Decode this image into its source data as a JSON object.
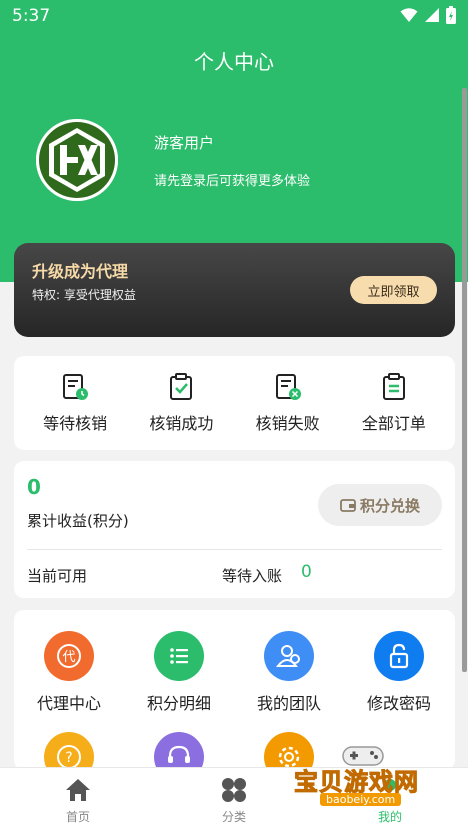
{
  "status_bar": {
    "time": "5:37"
  },
  "page_title": "个人中心",
  "user": {
    "name": "游客用户",
    "hint": "请先登录后可获得更多体验"
  },
  "vip": {
    "title": "升级成为代理",
    "subtitle": "特权: 享受代理权益",
    "button": "立即领取"
  },
  "orders": [
    {
      "label": "等待核销",
      "icon": "pending-verify-icon"
    },
    {
      "label": "核销成功",
      "icon": "verify-success-icon"
    },
    {
      "label": "核销失败",
      "icon": "verify-fail-icon"
    },
    {
      "label": "全部订单",
      "icon": "all-orders-icon"
    }
  ],
  "earnings": {
    "value": "0",
    "label": "累计收益(积分)",
    "exchange_button": "积分兑换",
    "available_label": "当前可用",
    "pending_label": "等待入账",
    "pending_value": "0"
  },
  "menu": [
    {
      "label": "代理中心",
      "color": "#f26b2e",
      "icon": "agent-icon",
      "glyph": "代"
    },
    {
      "label": "积分明细",
      "color": "#2bbd6b",
      "icon": "list-icon"
    },
    {
      "label": "我的团队",
      "color": "#3f8ef5",
      "icon": "team-icon"
    },
    {
      "label": "修改密码",
      "color": "#0f7df0",
      "icon": "lock-icon"
    },
    {
      "label": "",
      "color": "#f6ad1a",
      "icon": "help-icon"
    },
    {
      "label": "",
      "color": "#8b6fe0",
      "icon": "support-icon"
    },
    {
      "label": "",
      "color": "#f29a00",
      "icon": "settings-icon"
    }
  ],
  "tabs": [
    {
      "label": "首页",
      "icon": "home-icon"
    },
    {
      "label": "分类",
      "icon": "category-icon"
    },
    {
      "label": "我的",
      "icon": "profile-icon"
    }
  ],
  "watermark": {
    "text": "宝贝游戏网",
    "url": "baobeiy.com"
  },
  "colors": {
    "primary": "#2bbd6b",
    "vip_gold": "#f6d9a6"
  }
}
